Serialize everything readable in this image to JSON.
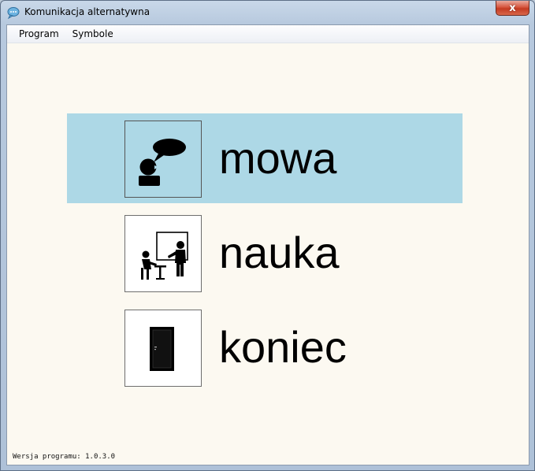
{
  "window": {
    "title": "Komunikacja alternatywna",
    "close_symbol": "x"
  },
  "menu": {
    "items": [
      "Program",
      "Symbole"
    ]
  },
  "options": [
    {
      "label": "mowa",
      "icon": "speaking-person-icon",
      "selected": true
    },
    {
      "label": "nauka",
      "icon": "classroom-teacher-icon",
      "selected": false
    },
    {
      "label": "koniec",
      "icon": "door-icon",
      "selected": false
    }
  ],
  "footer": {
    "version": "Wersja programu: 1.0.3.0"
  },
  "colors": {
    "selected_background": "#add8e6",
    "client_background": "#fcf9f1",
    "close_button": "#c43a22"
  }
}
